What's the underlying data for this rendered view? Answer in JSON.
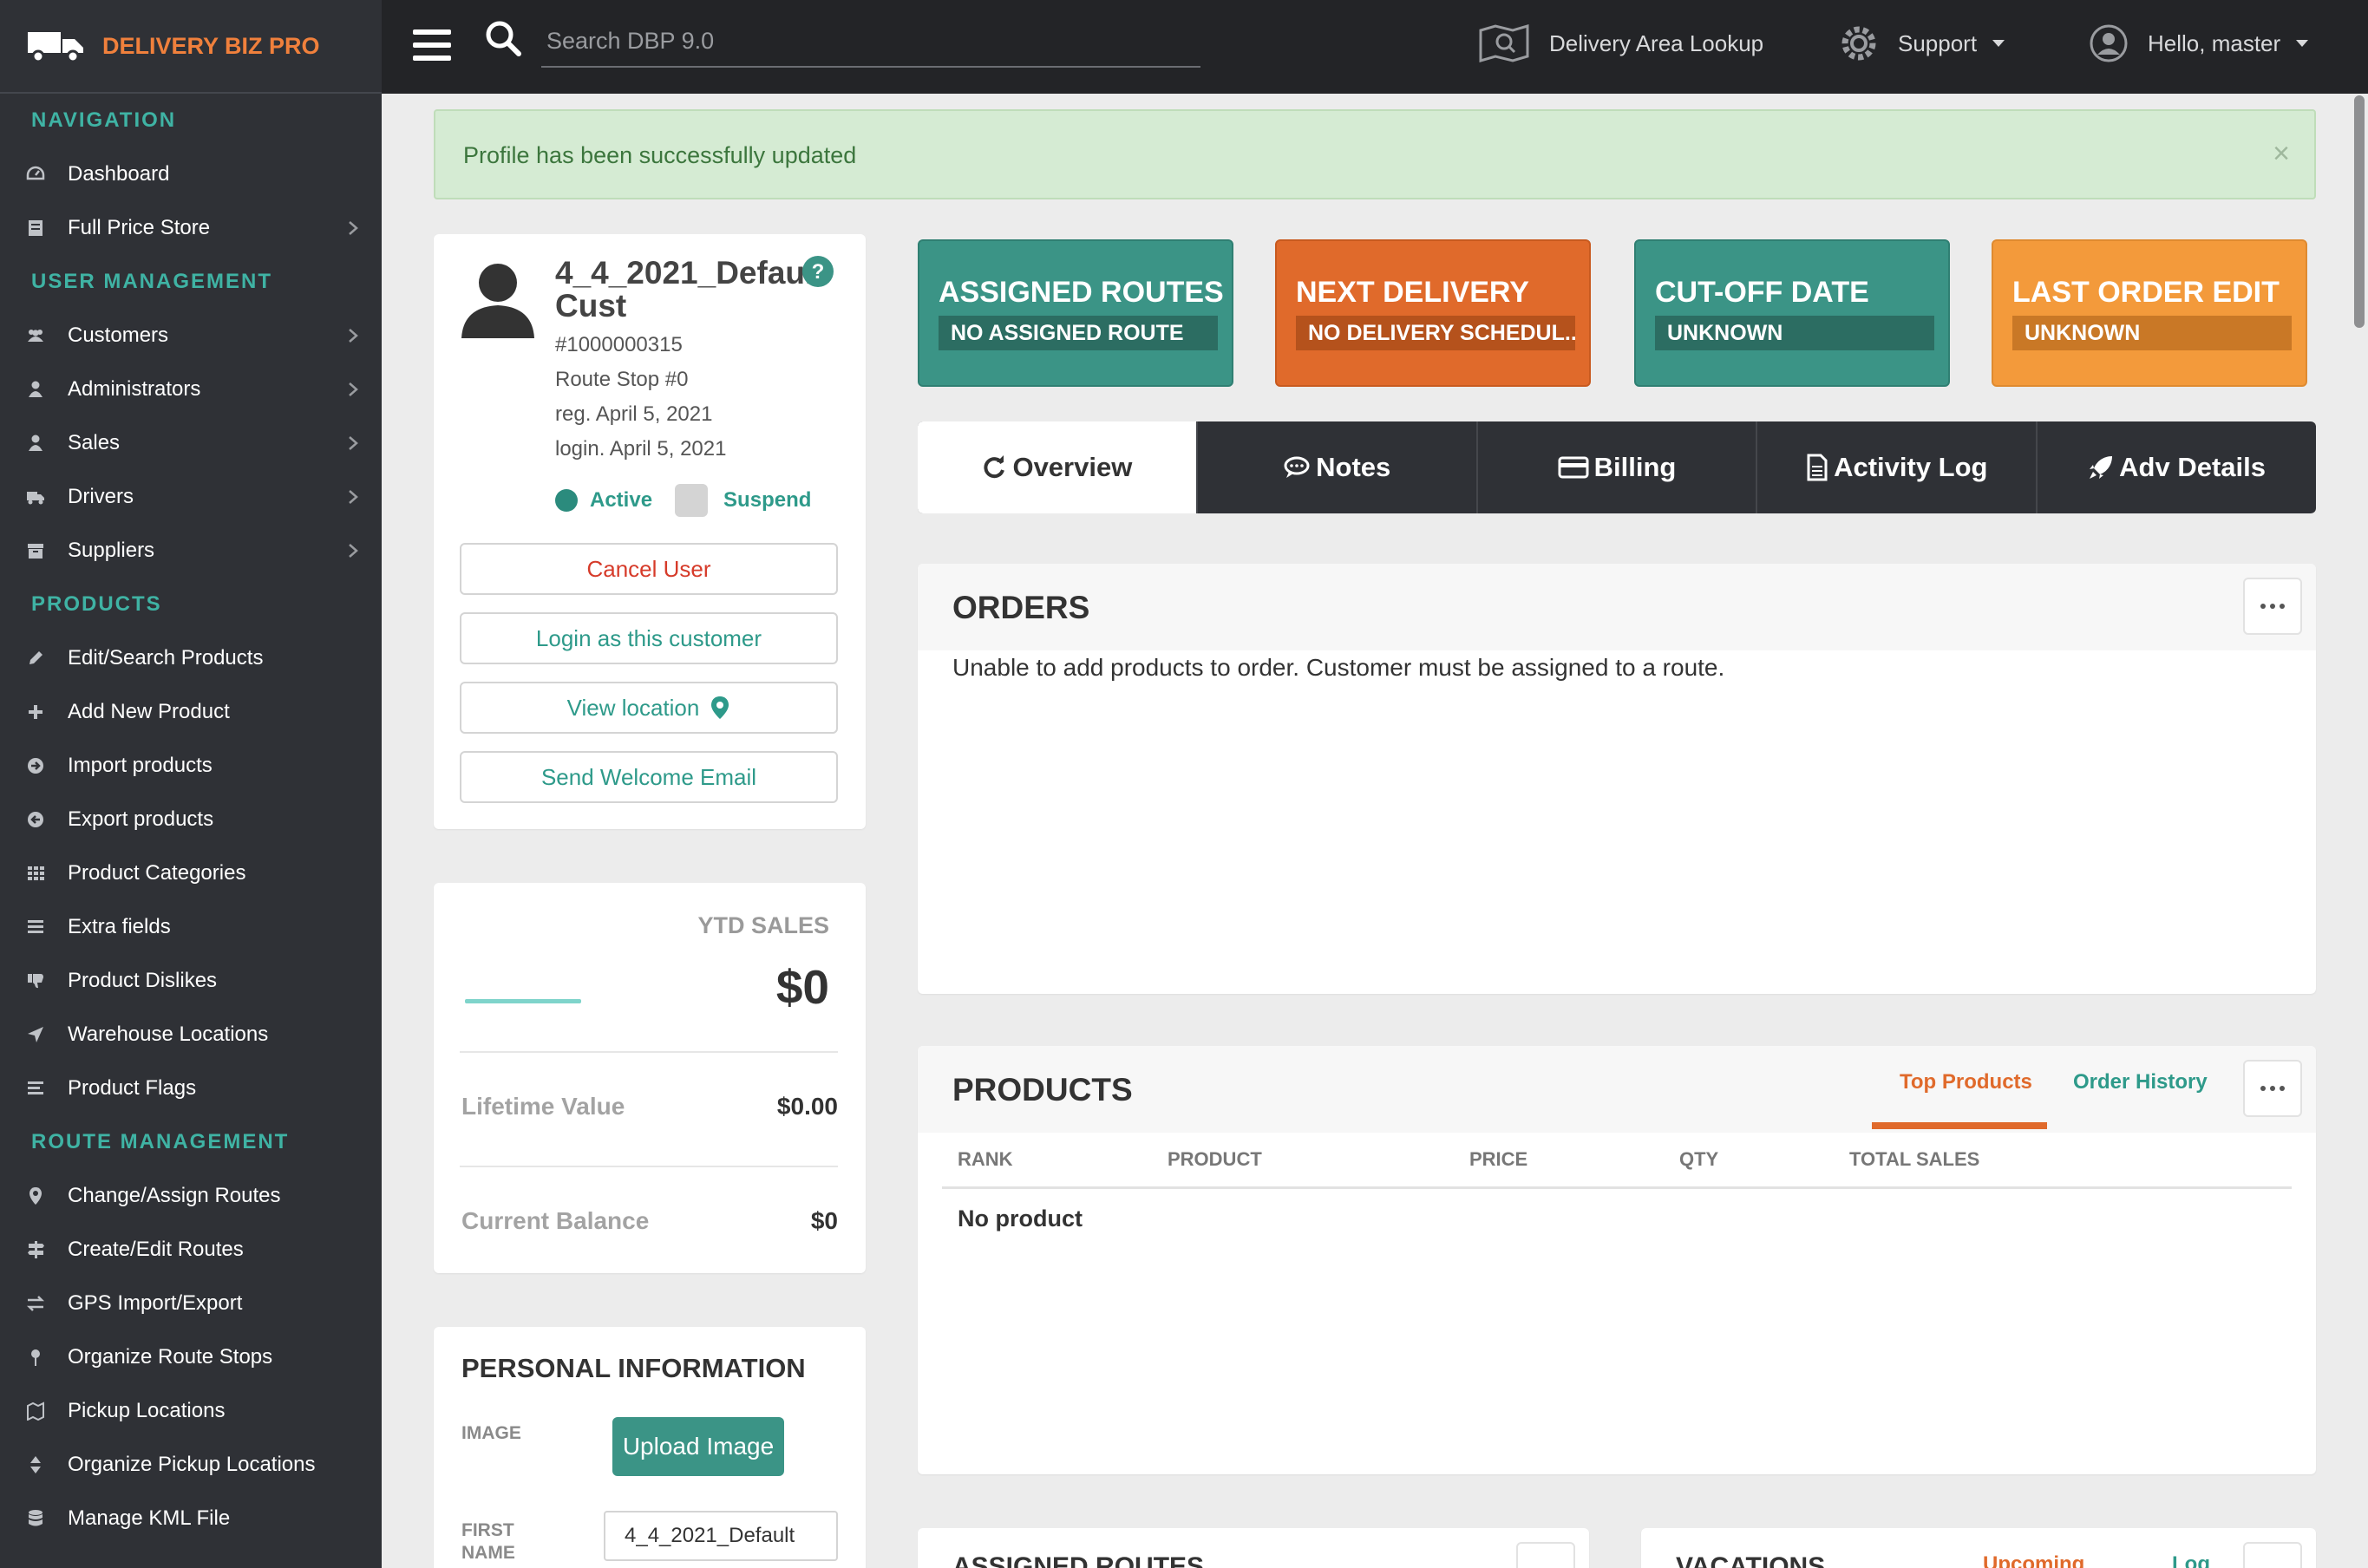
{
  "brand": {
    "name": "DELIVERY BIZ PRO",
    "icon": "truck-icon"
  },
  "sidebar": {
    "sections": [
      {
        "title": "NAVIGATION",
        "items": [
          {
            "label": "Dashboard",
            "icon": "dashboard-icon",
            "chevron": false
          },
          {
            "label": "Full Price Store",
            "icon": "store-icon",
            "chevron": true
          }
        ]
      },
      {
        "title": "USER MANAGEMENT",
        "items": [
          {
            "label": "Customers",
            "icon": "users-icon",
            "chevron": true
          },
          {
            "label": "Administrators",
            "icon": "user-icon",
            "chevron": true
          },
          {
            "label": "Sales",
            "icon": "user-icon",
            "chevron": true
          },
          {
            "label": "Drivers",
            "icon": "truck-icon",
            "chevron": true
          },
          {
            "label": "Suppliers",
            "icon": "archive-icon",
            "chevron": true
          }
        ]
      },
      {
        "title": "PRODUCTS",
        "items": [
          {
            "label": "Edit/Search Products",
            "icon": "pencil-icon",
            "chevron": false
          },
          {
            "label": "Add New Product",
            "icon": "plus-icon",
            "chevron": false
          },
          {
            "label": "Import products",
            "icon": "import-icon",
            "chevron": false
          },
          {
            "label": "Export products",
            "icon": "export-icon",
            "chevron": false
          },
          {
            "label": "Product Categories",
            "icon": "grid-icon",
            "chevron": false
          },
          {
            "label": "Extra fields",
            "icon": "list-icon",
            "chevron": false
          },
          {
            "label": "Product Dislikes",
            "icon": "thumbs-down-icon",
            "chevron": false
          },
          {
            "label": "Warehouse Locations",
            "icon": "location-arrow-icon",
            "chevron": false
          },
          {
            "label": "Product Flags",
            "icon": "flags-icon",
            "chevron": false
          }
        ]
      },
      {
        "title": "ROUTE MANAGEMENT",
        "items": [
          {
            "label": "Change/Assign Routes",
            "icon": "map-marker-icon",
            "chevron": false
          },
          {
            "label": "Create/Edit Routes",
            "icon": "signpost-icon",
            "chevron": false
          },
          {
            "label": "GPS Import/Export",
            "icon": "exchange-icon",
            "chevron": false
          },
          {
            "label": "Organize Route Stops",
            "icon": "pushpin-icon",
            "chevron": false
          },
          {
            "label": "Pickup Locations",
            "icon": "map-icon",
            "chevron": false
          },
          {
            "label": "Organize Pickup Locations",
            "icon": "sort-icon",
            "chevron": false
          },
          {
            "label": "Manage KML File",
            "icon": "database-icon",
            "chevron": false
          }
        ]
      }
    ]
  },
  "topbar": {
    "search_placeholder": "Search DBP 9.0",
    "area_lookup": "Delivery Area Lookup",
    "support": "Support",
    "greeting": "Hello, master"
  },
  "alert": {
    "text": "Profile has been successfully updated",
    "close": "×"
  },
  "profile": {
    "name": "4_4_2021_Default Cust",
    "id": "#1000000315",
    "route_stop": "Route Stop #0",
    "registered": "reg. April 5, 2021",
    "login": "login. April 5, 2021",
    "status_active": "Active",
    "status_suspend": "Suspend",
    "buttons": {
      "cancel": "Cancel User",
      "login_as": "Login as this customer",
      "view_location": "View location",
      "welcome_email": "Send Welcome Email"
    }
  },
  "ytd": {
    "label": "YTD SALES",
    "value": "$0",
    "lifetime_label": "Lifetime Value",
    "lifetime_value": "$0.00",
    "balance_label": "Current Balance",
    "balance_value": "$0"
  },
  "personal": {
    "title": "PERSONAL INFORMATION",
    "image_label": "IMAGE",
    "upload_button": "Upload Image",
    "first_name_label_1": "FIRST",
    "first_name_label_2": "NAME",
    "first_name_value": "4_4_2021_Default"
  },
  "tiles": {
    "routes": {
      "title": "ASSIGNED ROUTES",
      "value": "NO ASSIGNED ROUTE",
      "color": "#3b9486"
    },
    "delivery": {
      "title": "NEXT DELIVERY",
      "value": "NO DELIVERY SCHEDUL...",
      "color": "#e06a2b"
    },
    "cutoff": {
      "title": "CUT-OFF DATE",
      "value": "UNKNOWN",
      "color": "#3b9486"
    },
    "lastedit": {
      "title": "LAST ORDER EDIT",
      "value": "UNKNOWN",
      "color": "#f39a3b"
    }
  },
  "tabs": [
    {
      "label": "Overview",
      "icon": "refresh-icon",
      "active": true
    },
    {
      "label": "Notes",
      "icon": "comment-icon",
      "active": false
    },
    {
      "label": "Billing",
      "icon": "credit-card-icon",
      "active": false
    },
    {
      "label": "Activity Log",
      "icon": "file-icon",
      "active": false
    },
    {
      "label": "Adv Details",
      "icon": "rocket-icon",
      "active": false
    }
  ],
  "orders": {
    "title": "ORDERS",
    "message": "Unable to add products to order. Customer must be assigned to a route."
  },
  "products": {
    "title": "PRODUCTS",
    "tab_top": "Top Products",
    "tab_history": "Order History",
    "columns": [
      "RANK",
      "PRODUCT",
      "PRICE",
      "QTY",
      "TOTAL SALES"
    ],
    "empty": "No product"
  },
  "bottom": {
    "routes_title": "ASSIGNED ROUTES",
    "vacations_title": "VACATIONS",
    "vacations_tab_upcoming": "Upcoming",
    "vacations_tab_log": "Log"
  },
  "colors": {
    "teal": "#3b9486",
    "orange": "#e06a2b",
    "sidebar": "#2f3136",
    "topbar": "#232427"
  }
}
